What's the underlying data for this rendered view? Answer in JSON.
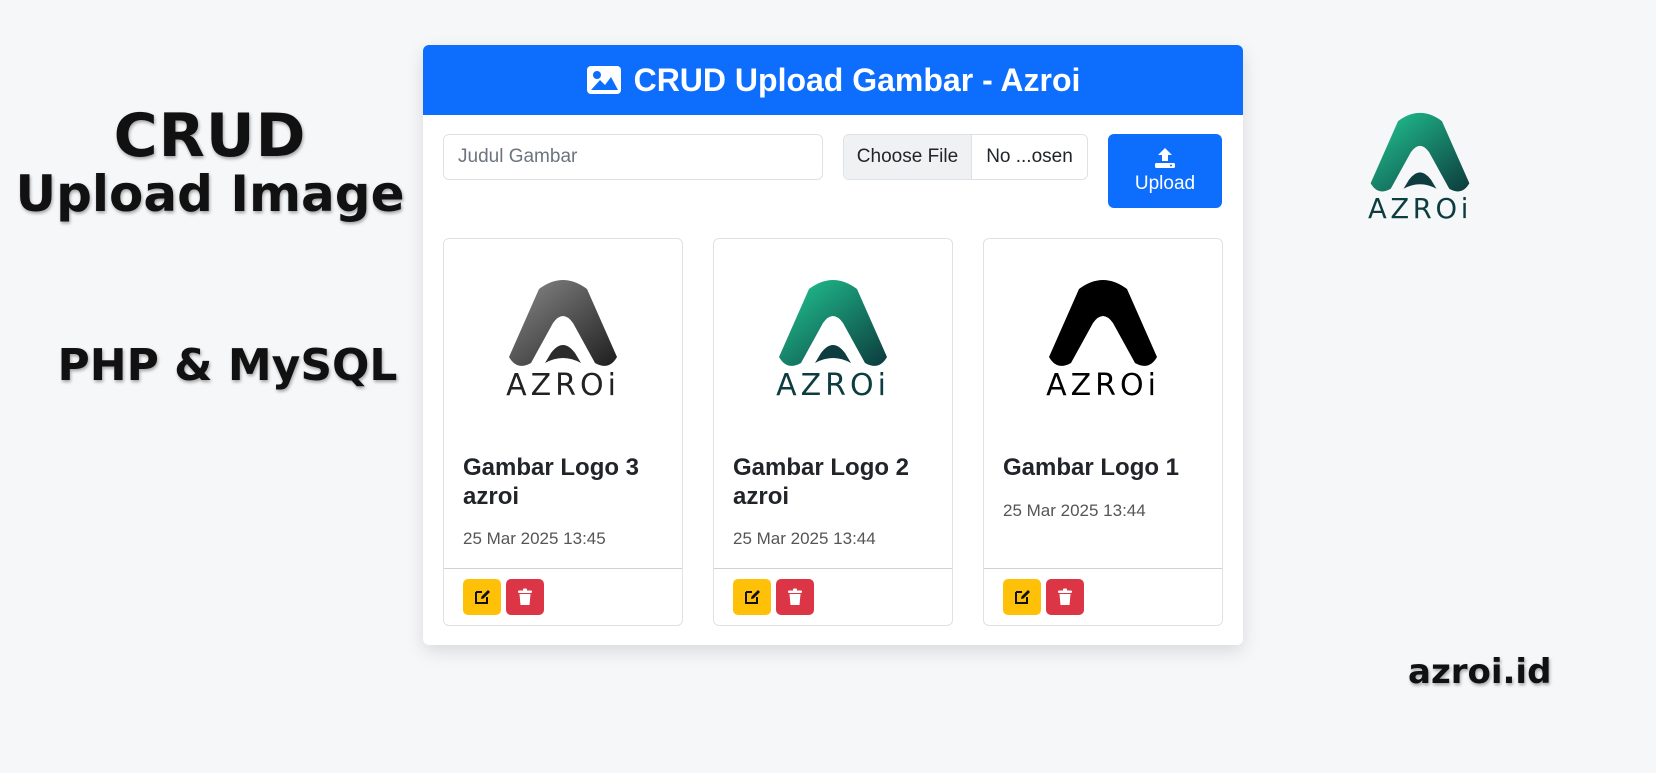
{
  "promo": {
    "title_line1": "CRUD",
    "title_line2": "Upload Image",
    "subtitle": "PHP & MySQL",
    "site": "azroi.id",
    "logo_text": "AZROi"
  },
  "app": {
    "header_icon": "image-icon",
    "title": "CRUD Upload Gambar - Azroi",
    "form": {
      "title_placeholder": "Judul Gambar",
      "title_value": "",
      "file_button": "Choose File",
      "file_name": "No ...osen",
      "upload_label": "Upload",
      "upload_icon": "upload-icon"
    },
    "cards": [
      {
        "title": "Gambar Logo 3 azroi",
        "date": "25 Mar 2025 13:45",
        "logo_style": "gray-gradient",
        "logo_text": "AZROi"
      },
      {
        "title": "Gambar Logo 2 azroi",
        "date": "25 Mar 2025 13:44",
        "logo_style": "teal-gradient",
        "logo_text": "AZROi"
      },
      {
        "title": "Gambar Logo 1",
        "date": "25 Mar 2025 13:44",
        "logo_style": "black",
        "logo_text": "AZROi"
      }
    ],
    "card_actions": {
      "edit_icon": "edit-icon",
      "delete_icon": "trash-icon"
    }
  },
  "colors": {
    "primary": "#0d6efd",
    "warning": "#ffc107",
    "danger": "#dc3545",
    "logo_teal": "#1fbf8f",
    "logo_dark": "#0e3d40"
  }
}
